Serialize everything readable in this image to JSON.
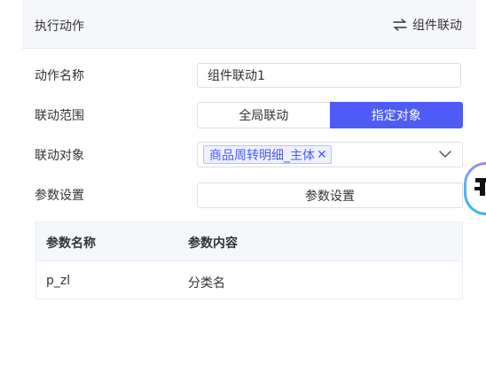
{
  "header": {
    "title": "执行动作",
    "link_mode_label": "组件联动",
    "link_mode_icon": "swap-arrows-icon"
  },
  "form": {
    "action_name": {
      "label": "动作名称",
      "value": "组件联动1"
    },
    "link_scope": {
      "label": "联动范围",
      "options": [
        "全局联动",
        "指定对象"
      ],
      "selected": "指定对象"
    },
    "link_target": {
      "label": "联动对象",
      "selected_tags": [
        "商品周转明细_主体"
      ],
      "dropdown_icon": "chevron-down-icon"
    },
    "param_settings": {
      "label": "参数设置",
      "button_label": "参数设置"
    }
  },
  "param_table": {
    "columns": [
      "参数名称",
      "参数内容"
    ],
    "rows": [
      [
        "p_zl",
        "分类名"
      ]
    ]
  },
  "colors": {
    "accent": "#4e5bf5",
    "header_bg": "#f5f7fa",
    "border": "#dcdfe6"
  }
}
